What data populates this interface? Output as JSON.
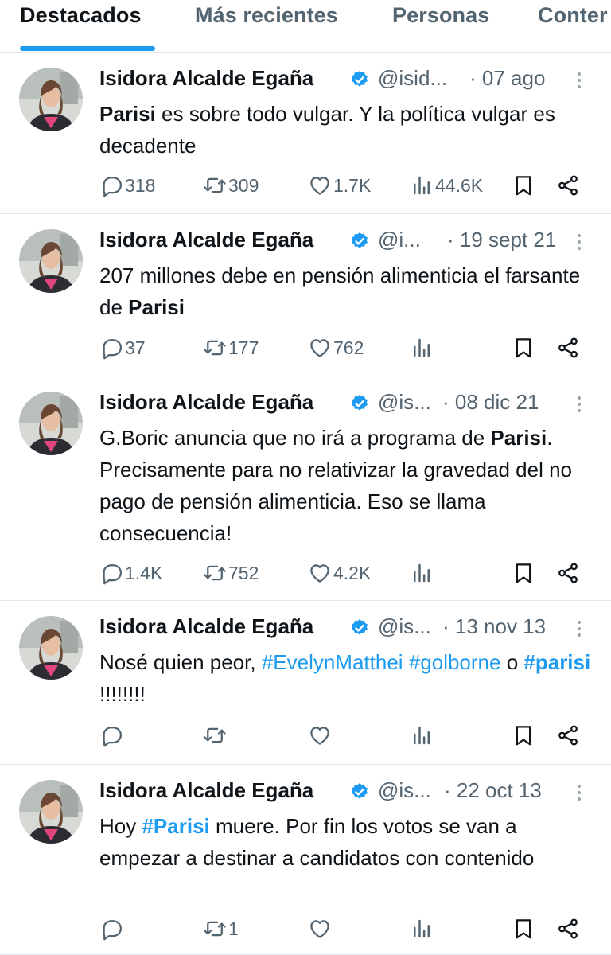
{
  "tabs": [
    {
      "label": "Destacados",
      "active": true
    },
    {
      "label": "Más recientes",
      "active": false
    },
    {
      "label": "Personas",
      "active": false
    },
    {
      "label": "Conter",
      "active": false
    }
  ],
  "author": {
    "name": "Isidora Alcalde Egaña",
    "verified_icon": "verified-badge-icon",
    "accent_color": "#1d9bf0"
  },
  "tweets": [
    {
      "handle": "@isid...",
      "date": "· 07 ago",
      "segments": [
        {
          "text": "Parisi",
          "style": "bold"
        },
        {
          "text": " es sobre todo vulgar. Y la política vulgar es decadente",
          "style": "plain"
        }
      ],
      "replies": "318",
      "retweets": "309",
      "likes": "1.7K",
      "views": "44.6K"
    },
    {
      "handle": "@i...",
      "date": "· 19 sept 21",
      "segments": [
        {
          "text": "207 millones debe en pensión alimenticia el farsante de ",
          "style": "plain"
        },
        {
          "text": "Parisi",
          "style": "bold"
        }
      ],
      "replies": "37",
      "retweets": "177",
      "likes": "762",
      "views": ""
    },
    {
      "handle": "@is...",
      "date": "· 08 dic 21",
      "segments": [
        {
          "text": "G.Boric anuncia que no irá a programa de ",
          "style": "plain"
        },
        {
          "text": "Parisi",
          "style": "bold"
        },
        {
          "text": ". Precisamente para no relativizar la gravedad del no pago de pensión alimenticia. Eso se llama consecuencia!",
          "style": "plain"
        }
      ],
      "replies": "1.4K",
      "retweets": "752",
      "likes": "4.2K",
      "views": ""
    },
    {
      "handle": "@is...",
      "date": "· 13 nov 13",
      "segments": [
        {
          "text": "Nosé quien peor, ",
          "style": "plain"
        },
        {
          "text": "#EvelynMatthei",
          "style": "tag"
        },
        {
          "text": " ",
          "style": "plain"
        },
        {
          "text": "#golborne",
          "style": "tag"
        },
        {
          "text": " o ",
          "style": "plain"
        },
        {
          "text": "#parisi",
          "style": "tag-bold"
        },
        {
          "text": " !!!!!!!!",
          "style": "plain"
        }
      ],
      "replies": "",
      "retweets": "",
      "likes": "",
      "views": ""
    },
    {
      "handle": "@is...",
      "date": "· 22 oct 13",
      "segments": [
        {
          "text": "Hoy ",
          "style": "plain"
        },
        {
          "text": "#Parisi",
          "style": "tag-bold"
        },
        {
          "text": " muere. Por fin los votos se van a empezar a destinar a candidatos con contenido",
          "style": "plain"
        }
      ],
      "replies": "",
      "retweets": "1",
      "likes": "",
      "views": ""
    }
  ]
}
